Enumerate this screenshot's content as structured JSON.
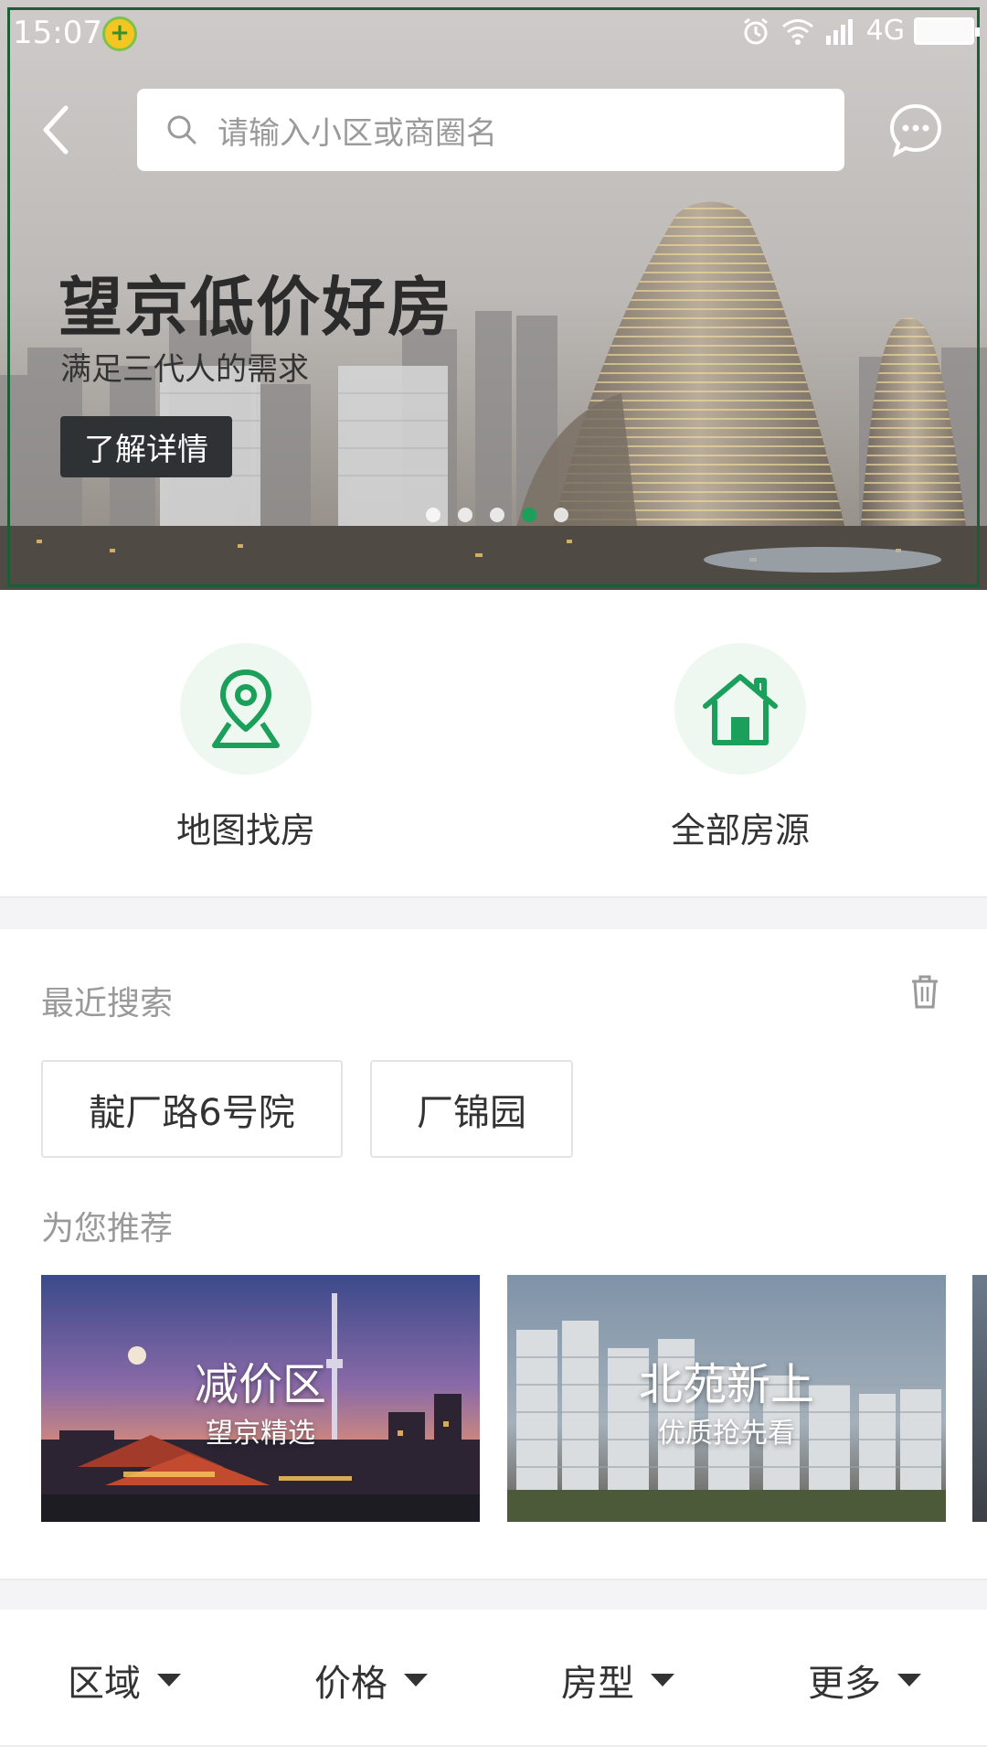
{
  "status_bar": {
    "time": "15:07",
    "network": "4G"
  },
  "search": {
    "placeholder": "请输入小区或商圈名"
  },
  "banner": {
    "title": "望京低价好房",
    "subtitle": "满足三代人的需求",
    "button_label": "了解详情",
    "slide_count": 5,
    "active_slide": 4
  },
  "quick_entries": [
    {
      "label": "地图找房",
      "icon": "map-pin-icon"
    },
    {
      "label": "全部房源",
      "icon": "house-icon"
    }
  ],
  "recent_search": {
    "title": "最近搜索",
    "items": [
      "靛厂路6号院",
      "厂锦园"
    ]
  },
  "recommend": {
    "title": "为您推荐",
    "cards": [
      {
        "title": "减价区",
        "subtitle": "望京精选"
      },
      {
        "title": "北苑新上",
        "subtitle": "优质抢先看"
      }
    ]
  },
  "filters": [
    "区域",
    "价格",
    "房型",
    "更多"
  ],
  "colors": {
    "accent": "#1aa05a",
    "icon_bg": "#eef8f1",
    "text": "#333333",
    "muted": "#999999"
  }
}
